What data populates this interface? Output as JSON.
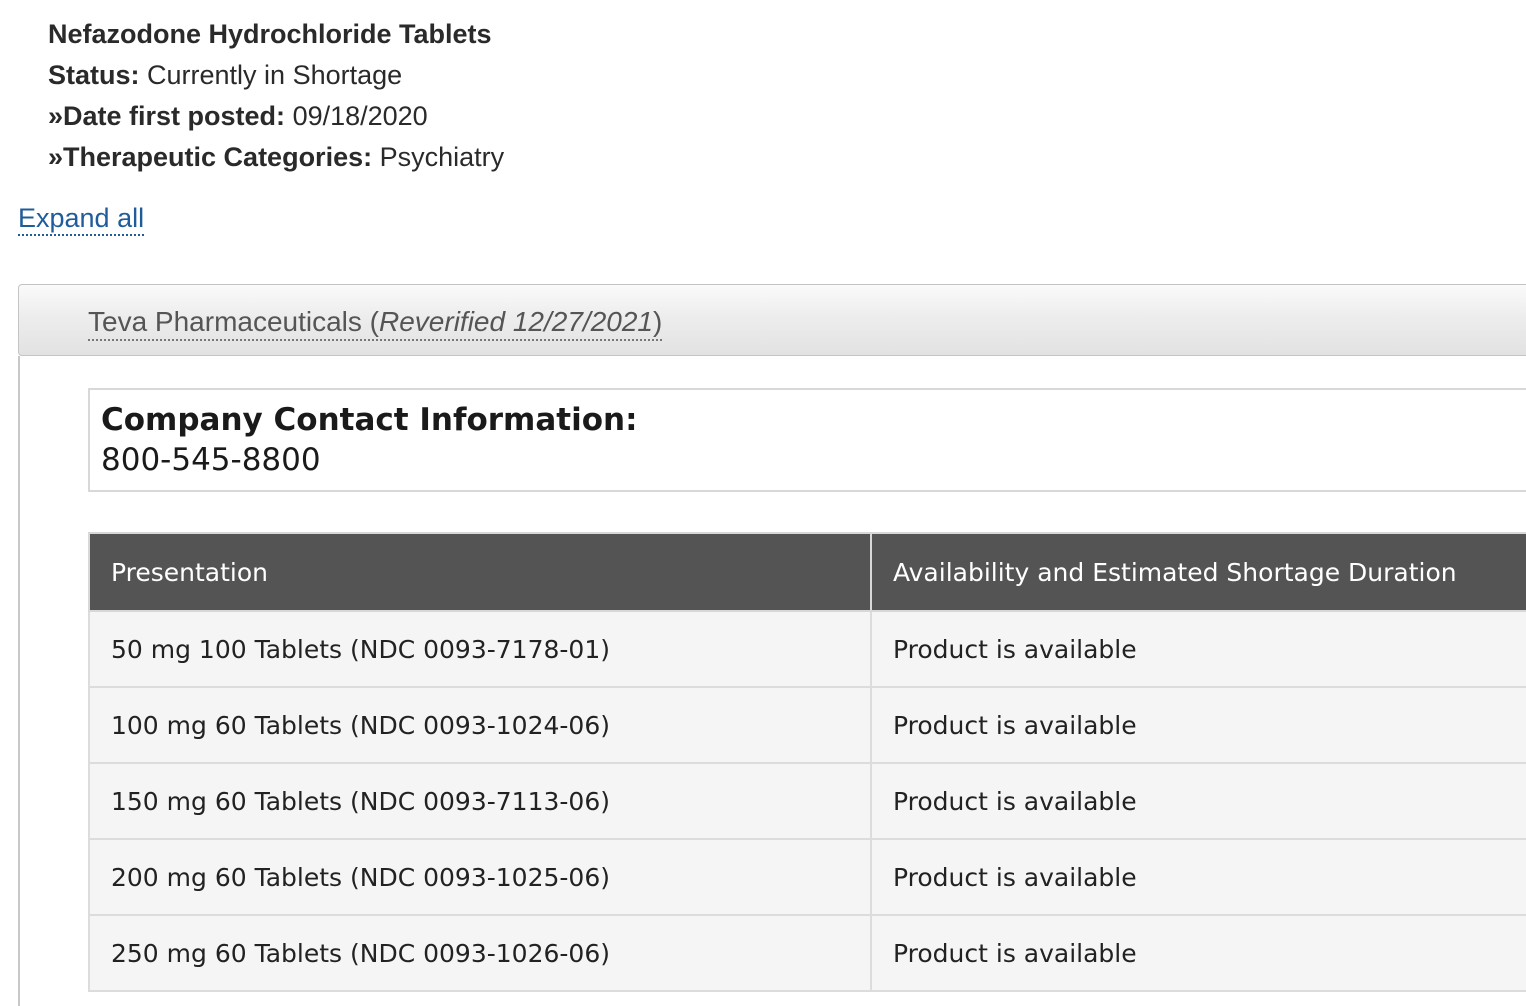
{
  "product": {
    "title": "Nefazodone Hydrochloride Tablets",
    "status_label": "Status:",
    "status_value": "Currently in Shortage",
    "date_label": "»Date first posted:",
    "date_value": "09/18/2020",
    "category_label": "»Therapeutic Categories:",
    "category_value": "Psychiatry"
  },
  "expand_all_label": "Expand all",
  "accordion": {
    "company": "Teva Pharmaceuticals",
    "open_paren": " (",
    "reverified": "Reverified 12/27/2021",
    "close_paren": ")"
  },
  "contact": {
    "label": "Company Contact Information:",
    "phone": "800-545-8800"
  },
  "table": {
    "headers": [
      "Presentation",
      "Availability and Estimated Shortage Duration"
    ],
    "rows": [
      [
        "50 mg 100 Tablets (NDC 0093-7178-01)",
        "Product is available"
      ],
      [
        "100 mg 60 Tablets (NDC 0093-1024-06)",
        "Product is available"
      ],
      [
        "150 mg 60 Tablets (NDC 0093-7113-06)",
        "Product is available"
      ],
      [
        "200 mg 60 Tablets (NDC 0093-1025-06)",
        "Product is available"
      ],
      [
        "250 mg 60 Tablets (NDC 0093-1026-06)",
        "Product is available"
      ]
    ]
  },
  "colors": {
    "link": "#1f5c99",
    "table_header_bg": "#545454",
    "table_row_bg": "#f5f5f5"
  }
}
